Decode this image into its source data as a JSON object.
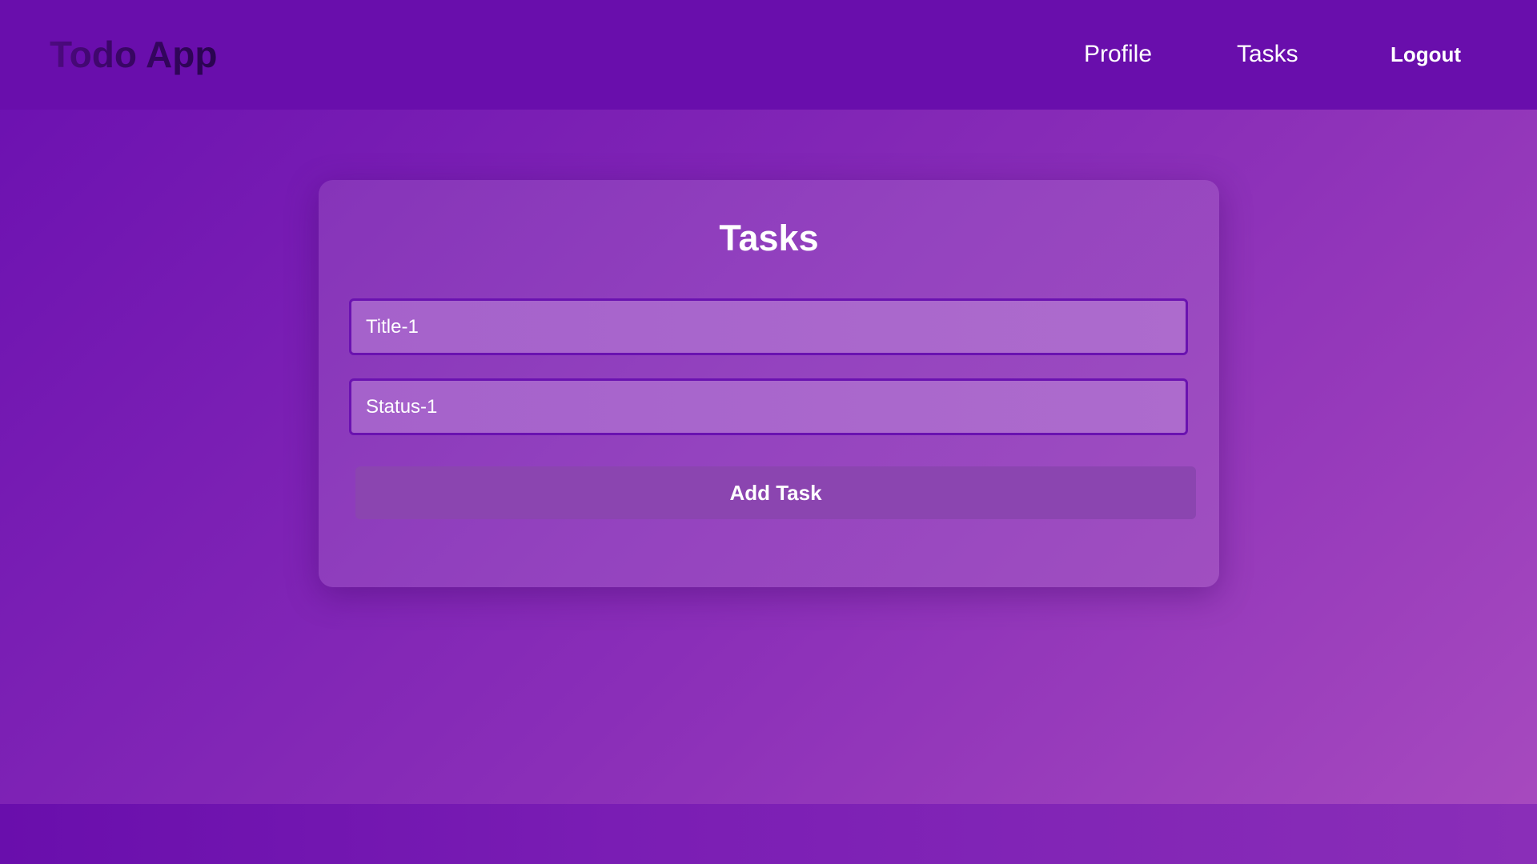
{
  "header": {
    "brand": "Todo App",
    "nav": {
      "profile_label": "Profile",
      "tasks_label": "Tasks",
      "logout_label": "Logout"
    }
  },
  "task_form": {
    "title": "Tasks",
    "title_field": {
      "value": "Title-1",
      "placeholder": "Title-1"
    },
    "status_field": {
      "value": "Status-1",
      "placeholder": "Status-1"
    },
    "submit_label": "Add Task"
  },
  "colors": {
    "navbar": "#690eac",
    "background_start": "#6a0fb0",
    "background_end": "#a84bbf",
    "card": "#9443bf",
    "field_border": "#6a12b0",
    "button": "#8b45b0",
    "text": "#ffffff"
  }
}
